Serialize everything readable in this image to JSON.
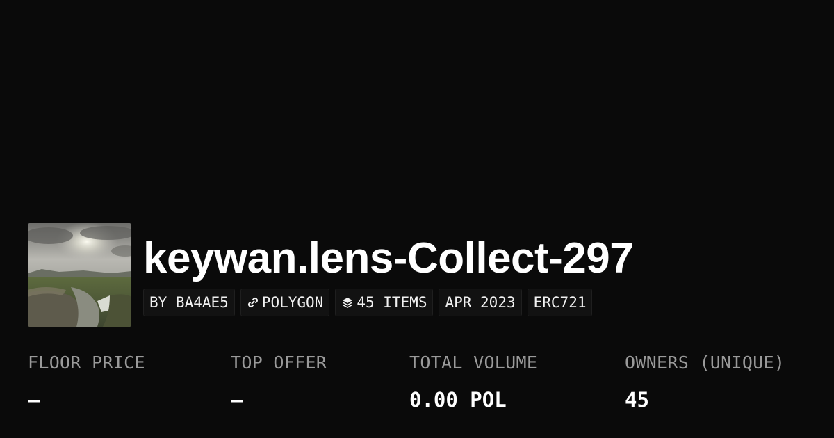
{
  "collection": {
    "title": "keywan.lens-Collect-297",
    "image_description_icon": "landscape-thumbnail"
  },
  "tags": {
    "creator": "BY BA4AE5",
    "chain": "POLYGON",
    "chain_icon": "link-icon",
    "items": "45 ITEMS",
    "items_icon": "layers-icon",
    "date": "APR 2023",
    "standard": "ERC721"
  },
  "stats": {
    "floor_price": {
      "label": "FLOOR PRICE",
      "value": "–"
    },
    "top_offer": {
      "label": "TOP OFFER",
      "value": "–"
    },
    "total_volume": {
      "label": "TOTAL VOLUME",
      "value": "0.00 POL"
    },
    "owners": {
      "label": "OWNERS (UNIQUE)",
      "value": "45"
    }
  },
  "colors": {
    "background": "#0a0a0a",
    "tag_background": "#121212",
    "label": "#9a9a9a",
    "text": "#ffffff"
  }
}
